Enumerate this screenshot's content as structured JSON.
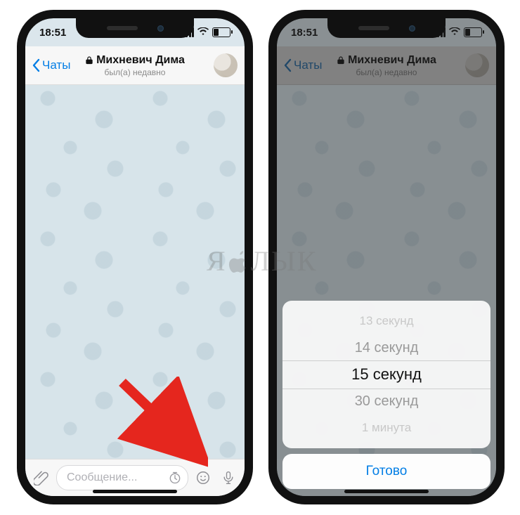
{
  "status": {
    "time": "18:51"
  },
  "nav": {
    "back_label": "Чаты",
    "title": "Михневич Дима",
    "subtitle": "был(а) недавно"
  },
  "input": {
    "placeholder": "Сообщение..."
  },
  "picker": {
    "options": {
      "faint_top": "13 секунд",
      "above": "14 секунд",
      "selected": "15 секунд",
      "below": "30 секунд",
      "faint_bottom": "1 минута"
    },
    "done": "Готово"
  },
  "watermark": {
    "prefix": "Я",
    "suffix": "ЛЫК"
  }
}
